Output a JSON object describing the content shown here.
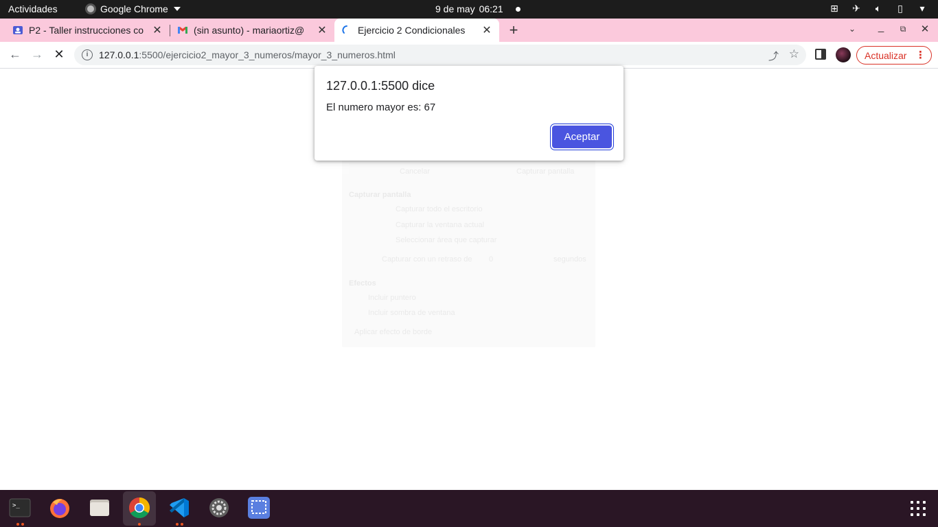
{
  "topbar": {
    "activities": "Actividades",
    "app_name": "Google Chrome",
    "date": "9 de may",
    "time": "06:21"
  },
  "tabs": [
    {
      "title": "P2 - Taller instrucciones co",
      "favicon": "classroom-icon",
      "active": false
    },
    {
      "title": "(sin asunto) - mariaortiz@",
      "favicon": "gmail-icon",
      "active": false
    },
    {
      "title": "Ejercicio 2 Condicionales",
      "favicon": "loading-spinner-icon",
      "active": true
    }
  ],
  "toolbar": {
    "url_host": "127.0.0.1",
    "url_path": ":5500/ejercicio2_mayor_3_numeros/mayor_3_numeros.html",
    "update_label": "Actualizar"
  },
  "dialog": {
    "title": "127.0.0.1:5500 dice",
    "message": "El numero mayor es: 67",
    "ok_label": "Aceptar"
  },
  "ghost_panel": {
    "cancel": "Cancelar",
    "capture": "Capturar pantalla",
    "heading": "Capturar pantalla",
    "opt1": "Capturar todo el escritorio",
    "opt2": "Capturar la ventana actual",
    "opt3": "Seleccionar área que capturar",
    "delay_label": "Capturar con un retraso de",
    "delay_value": "0",
    "delay_unit": "segundos",
    "effects": "Efectos",
    "pointer": "Incluir puntero",
    "shadow": "Incluir sombra de ventana",
    "border": "Aplicar efecto de borde"
  },
  "colors": {
    "tabstrip_bg": "#fbc9dc",
    "update_red": "#d93025",
    "dialog_button": "#4a55e0",
    "dock_bg": "#2a1625"
  },
  "dock": [
    "terminal-icon",
    "firefox-icon",
    "files-icon",
    "chrome-icon",
    "vscode-icon",
    "settings-icon",
    "screenshot-icon"
  ]
}
